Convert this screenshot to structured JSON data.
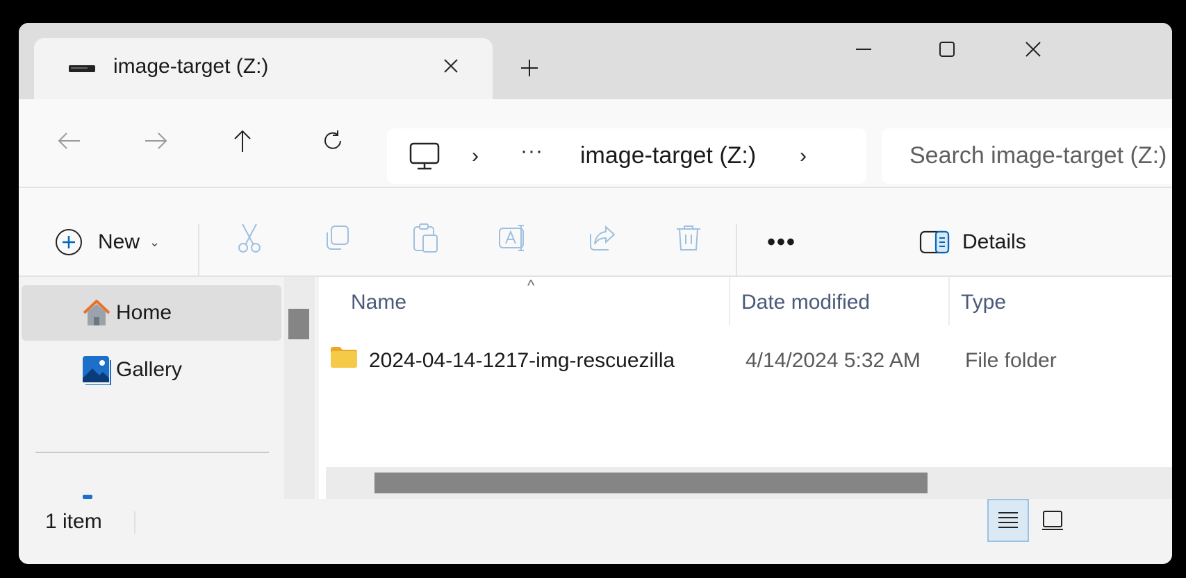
{
  "tab": {
    "title": "image-target (Z:)",
    "drive_icon": "drive-icon",
    "close_icon": "close-icon"
  },
  "window_controls": {
    "minimize_icon": "minimize-icon",
    "maximize_icon": "maximize-icon",
    "close_icon": "close-icon"
  },
  "nav": {
    "back_icon": "back-arrow-icon",
    "forward_icon": "forward-arrow-icon",
    "up_icon": "up-arrow-icon",
    "refresh_icon": "refresh-icon"
  },
  "address": {
    "overflow": "···",
    "crumb": "image-target (Z:)",
    "separator": "›"
  },
  "search": {
    "placeholder": "Search image-target (Z:)"
  },
  "commands": {
    "new_label": "New",
    "new_chevron": "⌄",
    "more": "•••",
    "details_label": "Details"
  },
  "sidebar": {
    "items": [
      {
        "label": "Home",
        "icon": "home-icon",
        "selected": true
      },
      {
        "label": "Gallery",
        "icon": "gallery-icon",
        "selected": false
      }
    ]
  },
  "columns": {
    "name": "Name",
    "date": "Date modified",
    "type": "Type",
    "sort_caret": "^"
  },
  "files": [
    {
      "name": "2024-04-14-1217-img-rescuezilla",
      "date": "4/14/2024 5:32 AM",
      "type": "File folder",
      "icon": "folder-icon"
    }
  ],
  "status": {
    "count": "1 item"
  },
  "colors": {
    "accent": "#0067c0",
    "folder": "#f7c948",
    "selected_bg": "#dedede"
  }
}
